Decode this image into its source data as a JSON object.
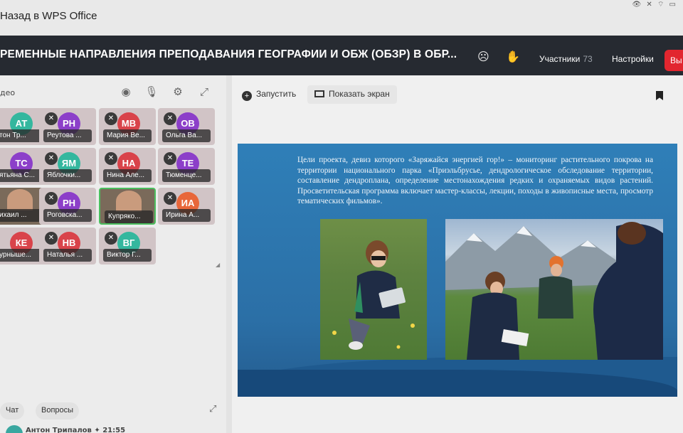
{
  "topbar": {
    "back_label": "Назад в WPS Office",
    "sys_icons": "👁 ✕ ⌔ ▭"
  },
  "header": {
    "title": "РЕМЕННЫЕ НАПРАВЛЕНИЯ ПРЕПОДАВАНИЯ ГЕОГРАФИИ И ОБЖ (ОБЗР) В ОБР...",
    "participants_label": "Участники",
    "participants_count": "73",
    "settings_label": "Настройки",
    "end_label": "Вы"
  },
  "video_panel": {
    "label": "део",
    "tiles": [
      {
        "initials": "АТ",
        "name": "тон Тр...",
        "color": "#34b79e",
        "muted": false,
        "video": false
      },
      {
        "initials": "РН",
        "name": "Реутова ...",
        "color": "#8c3fc9",
        "muted": true,
        "video": false
      },
      {
        "initials": "МВ",
        "name": "Мария Ве...",
        "color": "#d9434a",
        "muted": true,
        "video": false
      },
      {
        "initials": "ОВ",
        "name": "Ольга Ва...",
        "color": "#8c3fc9",
        "muted": true,
        "video": false
      },
      {
        "initials": "ТС",
        "name": "ятьяна С...",
        "color": "#8c3fc9",
        "muted": false,
        "video": false
      },
      {
        "initials": "ЯМ",
        "name": "Яблочки...",
        "color": "#34b79e",
        "muted": true,
        "video": false
      },
      {
        "initials": "НА",
        "name": "Нина Але...",
        "color": "#d9434a",
        "muted": true,
        "video": false
      },
      {
        "initials": "ТЕ",
        "name": "Тюменце...",
        "color": "#8c3fc9",
        "muted": true,
        "video": false
      },
      {
        "initials": "",
        "name": "ихаил ...",
        "color": "#6b5a4a",
        "muted": false,
        "video": true
      },
      {
        "initials": "РН",
        "name": "Роговска...",
        "color": "#8c3fc9",
        "muted": true,
        "video": false
      },
      {
        "initials": "",
        "name": "Купряко...",
        "color": "#6b5a4a",
        "muted": false,
        "video": true
      },
      {
        "initials": "ИА",
        "name": "Ирина А...",
        "color": "#e8673a",
        "muted": true,
        "video": false
      },
      {
        "initials": "КЕ",
        "name": "урныше...",
        "color": "#d9434a",
        "muted": false,
        "video": false
      },
      {
        "initials": "НВ",
        "name": "Наталья ...",
        "color": "#d9434a",
        "muted": true,
        "video": false
      },
      {
        "initials": "ВГ",
        "name": "Виктор Г...",
        "color": "#34b79e",
        "muted": true,
        "video": false
      }
    ]
  },
  "chat": {
    "tab_chat": "Чат",
    "tab_questions": "Вопросы",
    "last_author": "Антон Трипалов ✦  21:55"
  },
  "main": {
    "start_label": "Запустить",
    "share_label": "Показать экран"
  },
  "slide": {
    "text": "Цели проекта, девиз которого «Заряжайся энергией гор!» – мониторинг растительного покрова на территории национального парка «Приэльбрусье, дендрологическое обследование территории, составление дендроплана, определение местонахождения редких и охраняемых видов растений. Просветительская программа включает мастер-классы, лекции, походы в живописные места, просмотр тематических фильмов»."
  }
}
